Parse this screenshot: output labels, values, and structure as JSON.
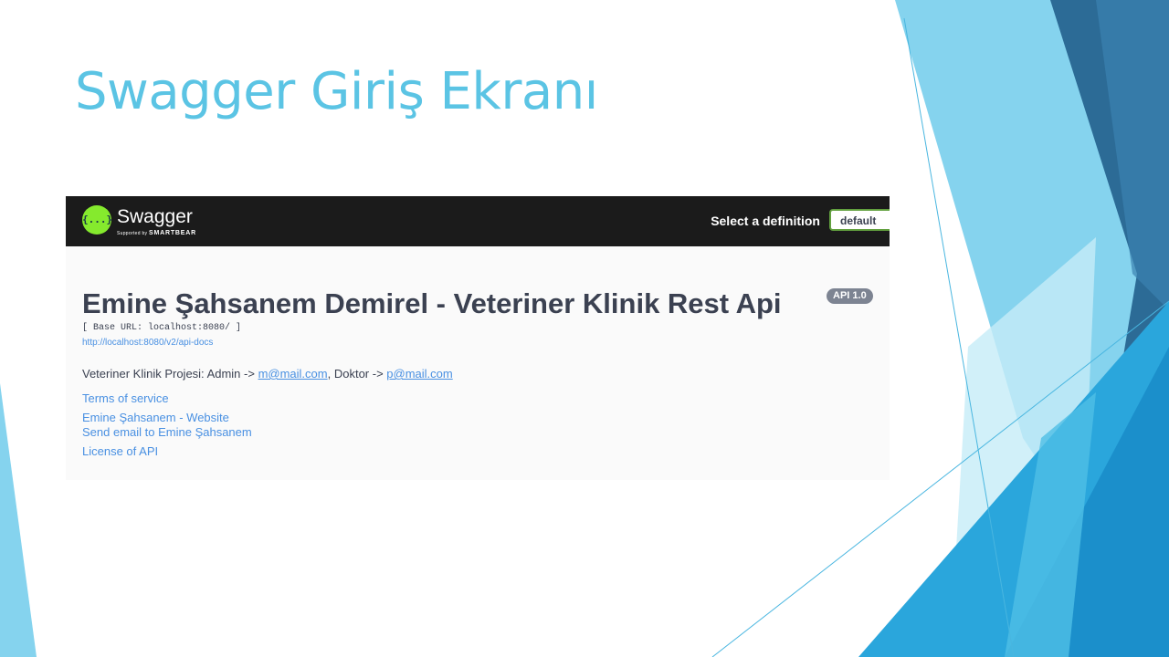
{
  "slide": {
    "title": "Swagger Giriş Ekranı",
    "colors": {
      "title": "#5bc4e4",
      "accent_dark": "#2c6b96",
      "accent_mid": "#2aa6dc",
      "accent_light": "#85d3ee"
    }
  },
  "swagger": {
    "logo_icon_text": "{...}",
    "logo_name": "Swagger",
    "logo_sub_prefix": "Supported by",
    "logo_sub_brand": "SMARTBEAR",
    "select_label": "Select a definition",
    "select_value": "default",
    "title": "Emine Şahsanem Demirel - Veteriner Klinik Rest Api",
    "version": "API 1.0",
    "base_url": "[ Base URL: localhost:8080/ ]",
    "docs_url": "http://localhost:8080/v2/api-docs",
    "description": {
      "prefix": "Veteriner Klinik Projesi: Admin -> ",
      "admin_email": "m@mail.com",
      "middle": ", Doktor -> ",
      "doctor_email": "p@mail.com"
    },
    "links": {
      "terms": "Terms of service",
      "website": "Emine Şahsanem - Website",
      "email": "Send email to Emine Şahsanem",
      "license": "License of API"
    },
    "colors": {
      "topbar": "#1b1b1b",
      "logo_green": "#85ea2d",
      "link": "#4990e2",
      "text": "#3b4151"
    }
  }
}
